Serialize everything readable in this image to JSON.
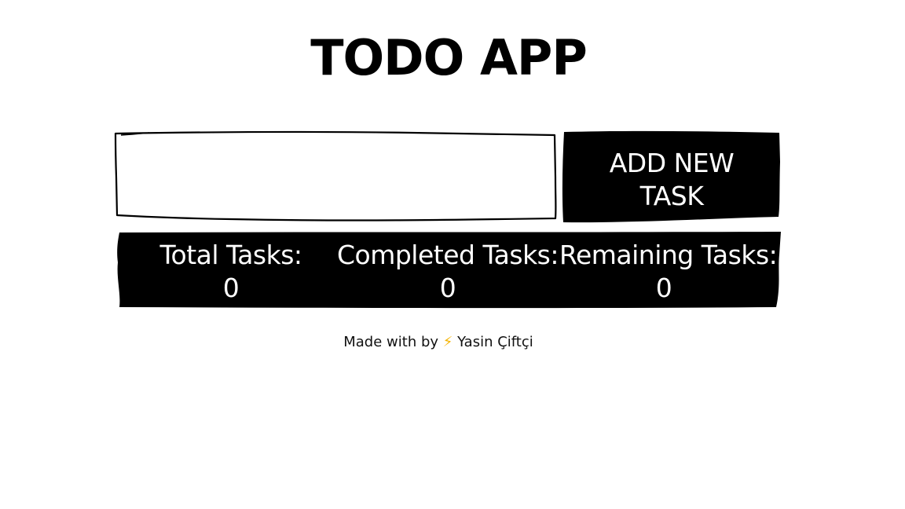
{
  "header": {
    "title": "TODO APP"
  },
  "task_form": {
    "input_value": "",
    "input_placeholder": "",
    "add_button_line1": "ADD NEW",
    "add_button_line2": "TASK"
  },
  "stats": {
    "total_label": "Total Tasks:",
    "total_value": "0",
    "completed_label": "Completed Tasks:",
    "completed_value": "0",
    "remaining_label": "Remaining Tasks:",
    "remaining_value": "0"
  },
  "footer": {
    "prefix": "Made with by",
    "icon": "lightning-bolt-icon",
    "icon_glyph": "⚡",
    "author": "Yasin Çiftçi"
  },
  "colors": {
    "background": "#ffffff",
    "ink": "#000000",
    "bolt": "#f5b400"
  }
}
